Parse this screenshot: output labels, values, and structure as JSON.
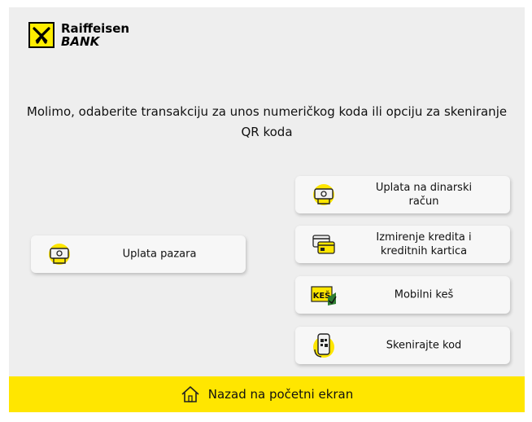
{
  "brand": {
    "line1": "Raiffeisen",
    "line2": "BANK"
  },
  "instruction": "Molimo, odaberite transakciju za unos numeričkog koda ili opciju za skeniranje QR koda",
  "buttons": {
    "uplata_pazara": "Uplata pazara",
    "dinarski_line1": "Uplata na dinarski",
    "dinarski_line2": "račun",
    "krediti_line1": "Izmirenje kredita i",
    "krediti_line2": "kreditnih kartica",
    "mobilni_kes": "Mobilni keš",
    "skenirajte": "Skenirajte kod"
  },
  "icons": {
    "deposit": "cash-deposit-icon",
    "credit": "credit-card-icon",
    "kes": "kes-badge-icon",
    "scan": "qr-phone-scan-icon",
    "home": "home-icon"
  },
  "kes_badge": "KEŠ",
  "home_button": "Nazad na početni ekran",
  "colors": {
    "accent": "#ffe600",
    "background": "#eeeeee",
    "button": "#f7f7f7"
  }
}
